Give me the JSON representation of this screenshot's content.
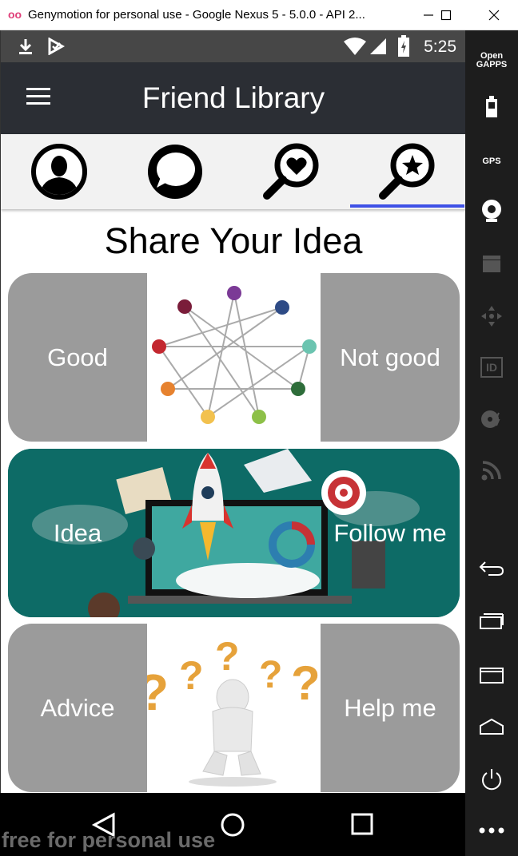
{
  "window": {
    "logo": "oo",
    "title": "Genymotion for personal use - Google Nexus 5 - 5.0.0 - API 2..."
  },
  "statusbar": {
    "time": "5:25"
  },
  "appbar": {
    "title": "Friend Library"
  },
  "tabs": [
    {
      "name": "profile",
      "icon": "person-icon"
    },
    {
      "name": "chat",
      "icon": "chat-bubble-icon"
    },
    {
      "name": "search-love",
      "icon": "search-heart-icon"
    },
    {
      "name": "search-star",
      "icon": "search-star-icon",
      "active": true
    }
  ],
  "headline": "Share Your Idea",
  "cards": [
    {
      "left": "Good",
      "right": "Not good",
      "image": "enneagram-diagram"
    },
    {
      "left": "Idea",
      "right": "Follow me",
      "image": "rocket-laptop-illustration"
    },
    {
      "left": "Advice",
      "right": "Help me",
      "image": "thinking-figure-question-marks"
    }
  ],
  "navbar": {
    "watermark": "free for personal use"
  },
  "sidepanel": {
    "gapps_label": "Open GAPPS",
    "gps_label": "GPS",
    "id_label": "ID"
  },
  "colors": {
    "appbar": "#2b2e34",
    "tab_indicator": "#3f51e6",
    "card_grey": "#9b9b9b",
    "card_teal": "#0d6b66"
  }
}
